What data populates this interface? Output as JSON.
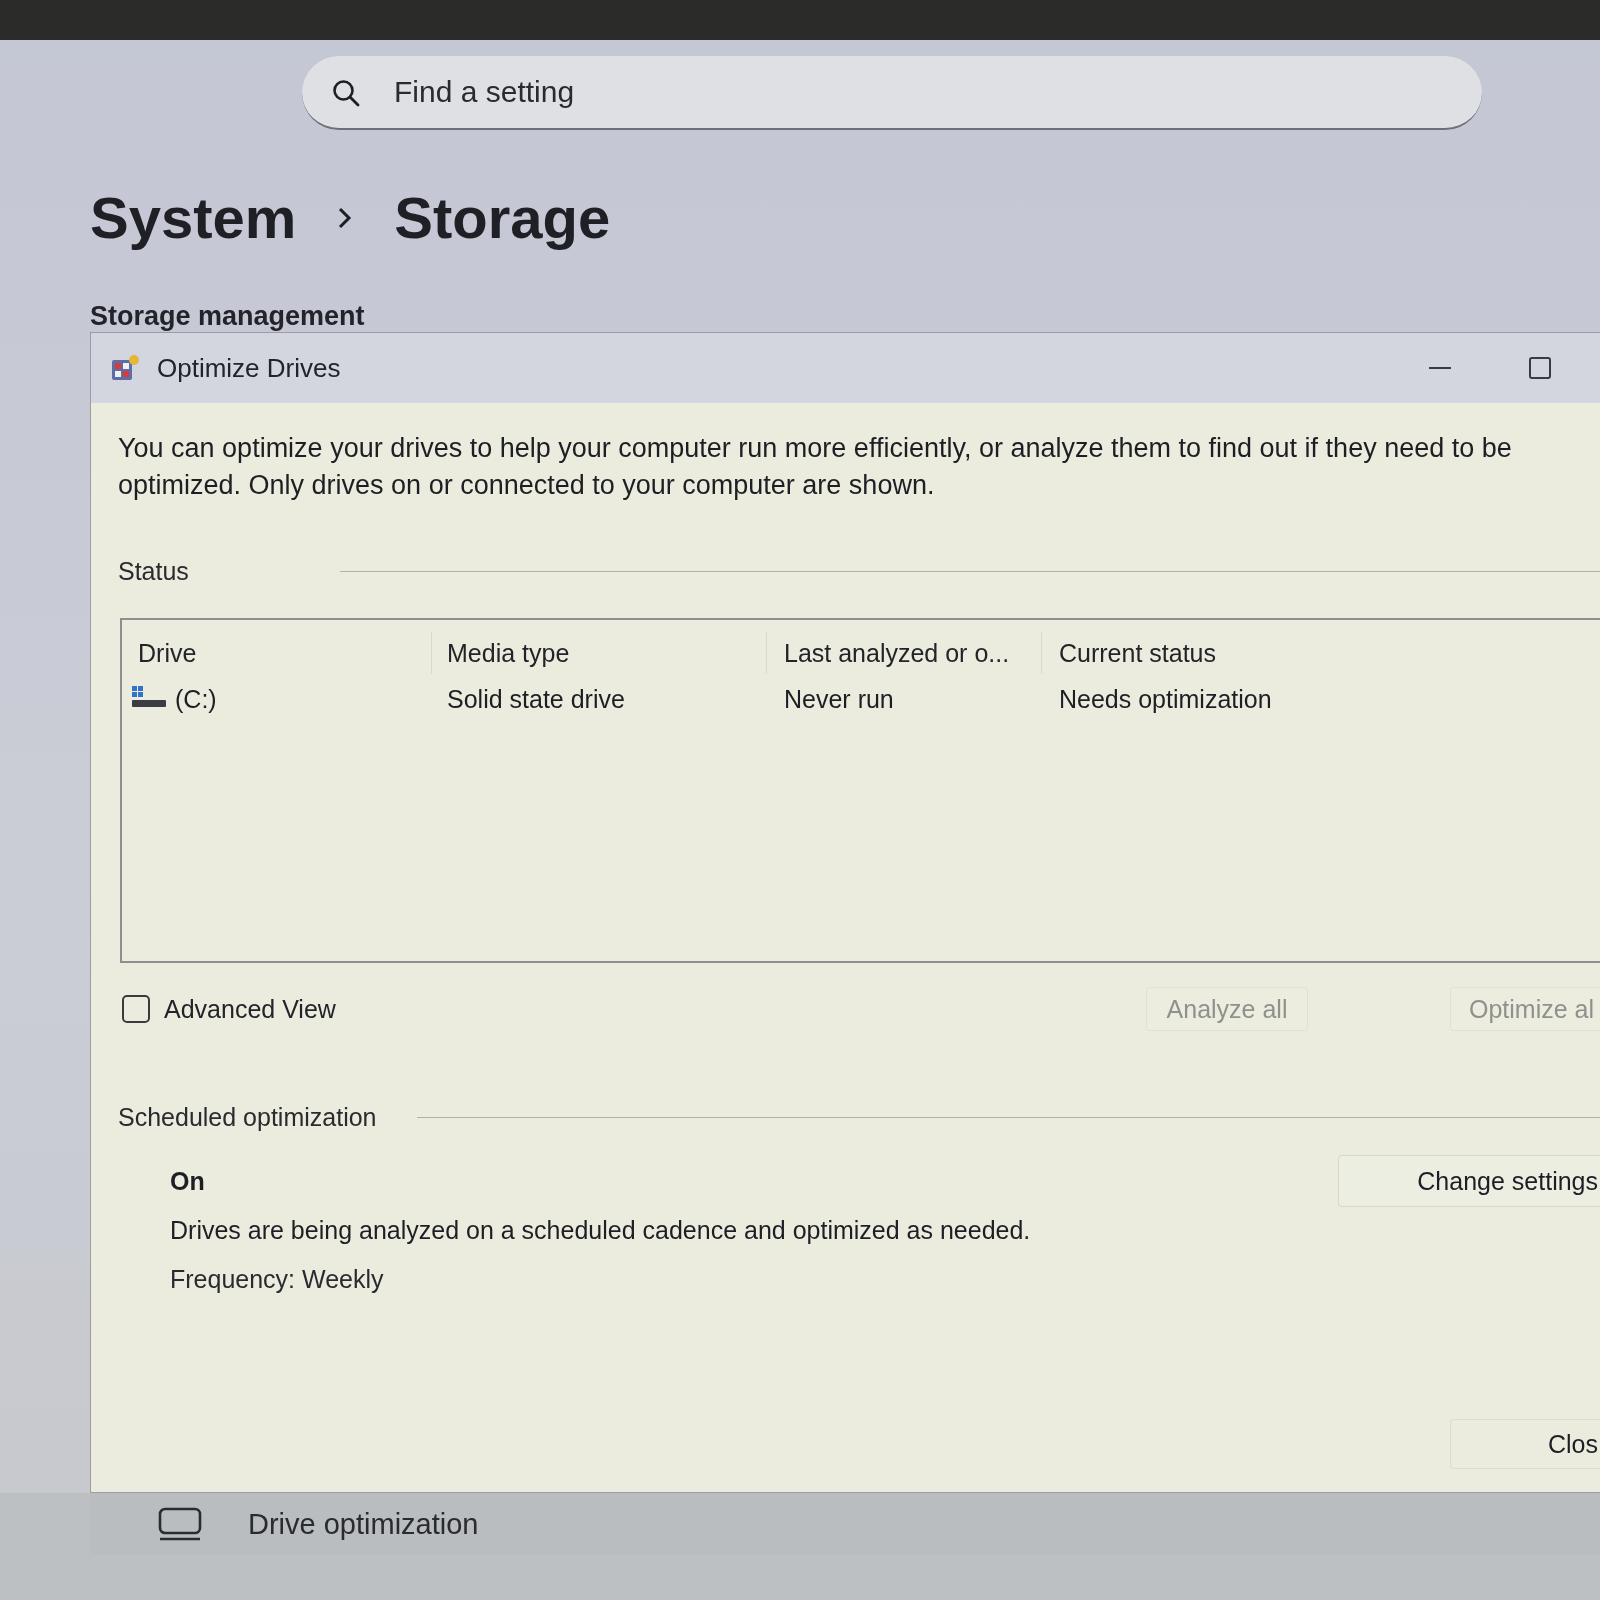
{
  "search": {
    "placeholder": "Find a setting"
  },
  "breadcrumb": [
    "System",
    "Storage"
  ],
  "section_heading": "Storage management",
  "dialog": {
    "title": "Optimize Drives",
    "description": "You can optimize your drives to help your computer run more efficiently, or analyze them to find out if they need to be optimized. Only drives on or connected to your computer are shown.",
    "status_label": "Status",
    "table": {
      "columns": [
        "Drive",
        "Media type",
        "Last analyzed or o...",
        "Current status"
      ],
      "rows": [
        {
          "cells": [
            "(C:)",
            "Solid state drive",
            "Never run",
            "Needs optimization"
          ]
        }
      ]
    },
    "advanced_view": {
      "label": "Advanced View",
      "checked": false
    },
    "buttons": [
      {
        "label": "Analyze all",
        "disabled": true
      },
      {
        "label": "Optimize al",
        "disabled": true
      }
    ],
    "scheduled": {
      "label": "Scheduled optimization",
      "state": "On",
      "description": "Drives are being analyzed on a scheduled cadence and optimized as needed.",
      "frequency": "Frequency: Weekly",
      "button": {
        "label": "Change settings",
        "disabled": false
      }
    },
    "close_button": {
      "label": "Clos",
      "disabled": false
    }
  },
  "bottom_item": {
    "label": "Drive optimization"
  }
}
